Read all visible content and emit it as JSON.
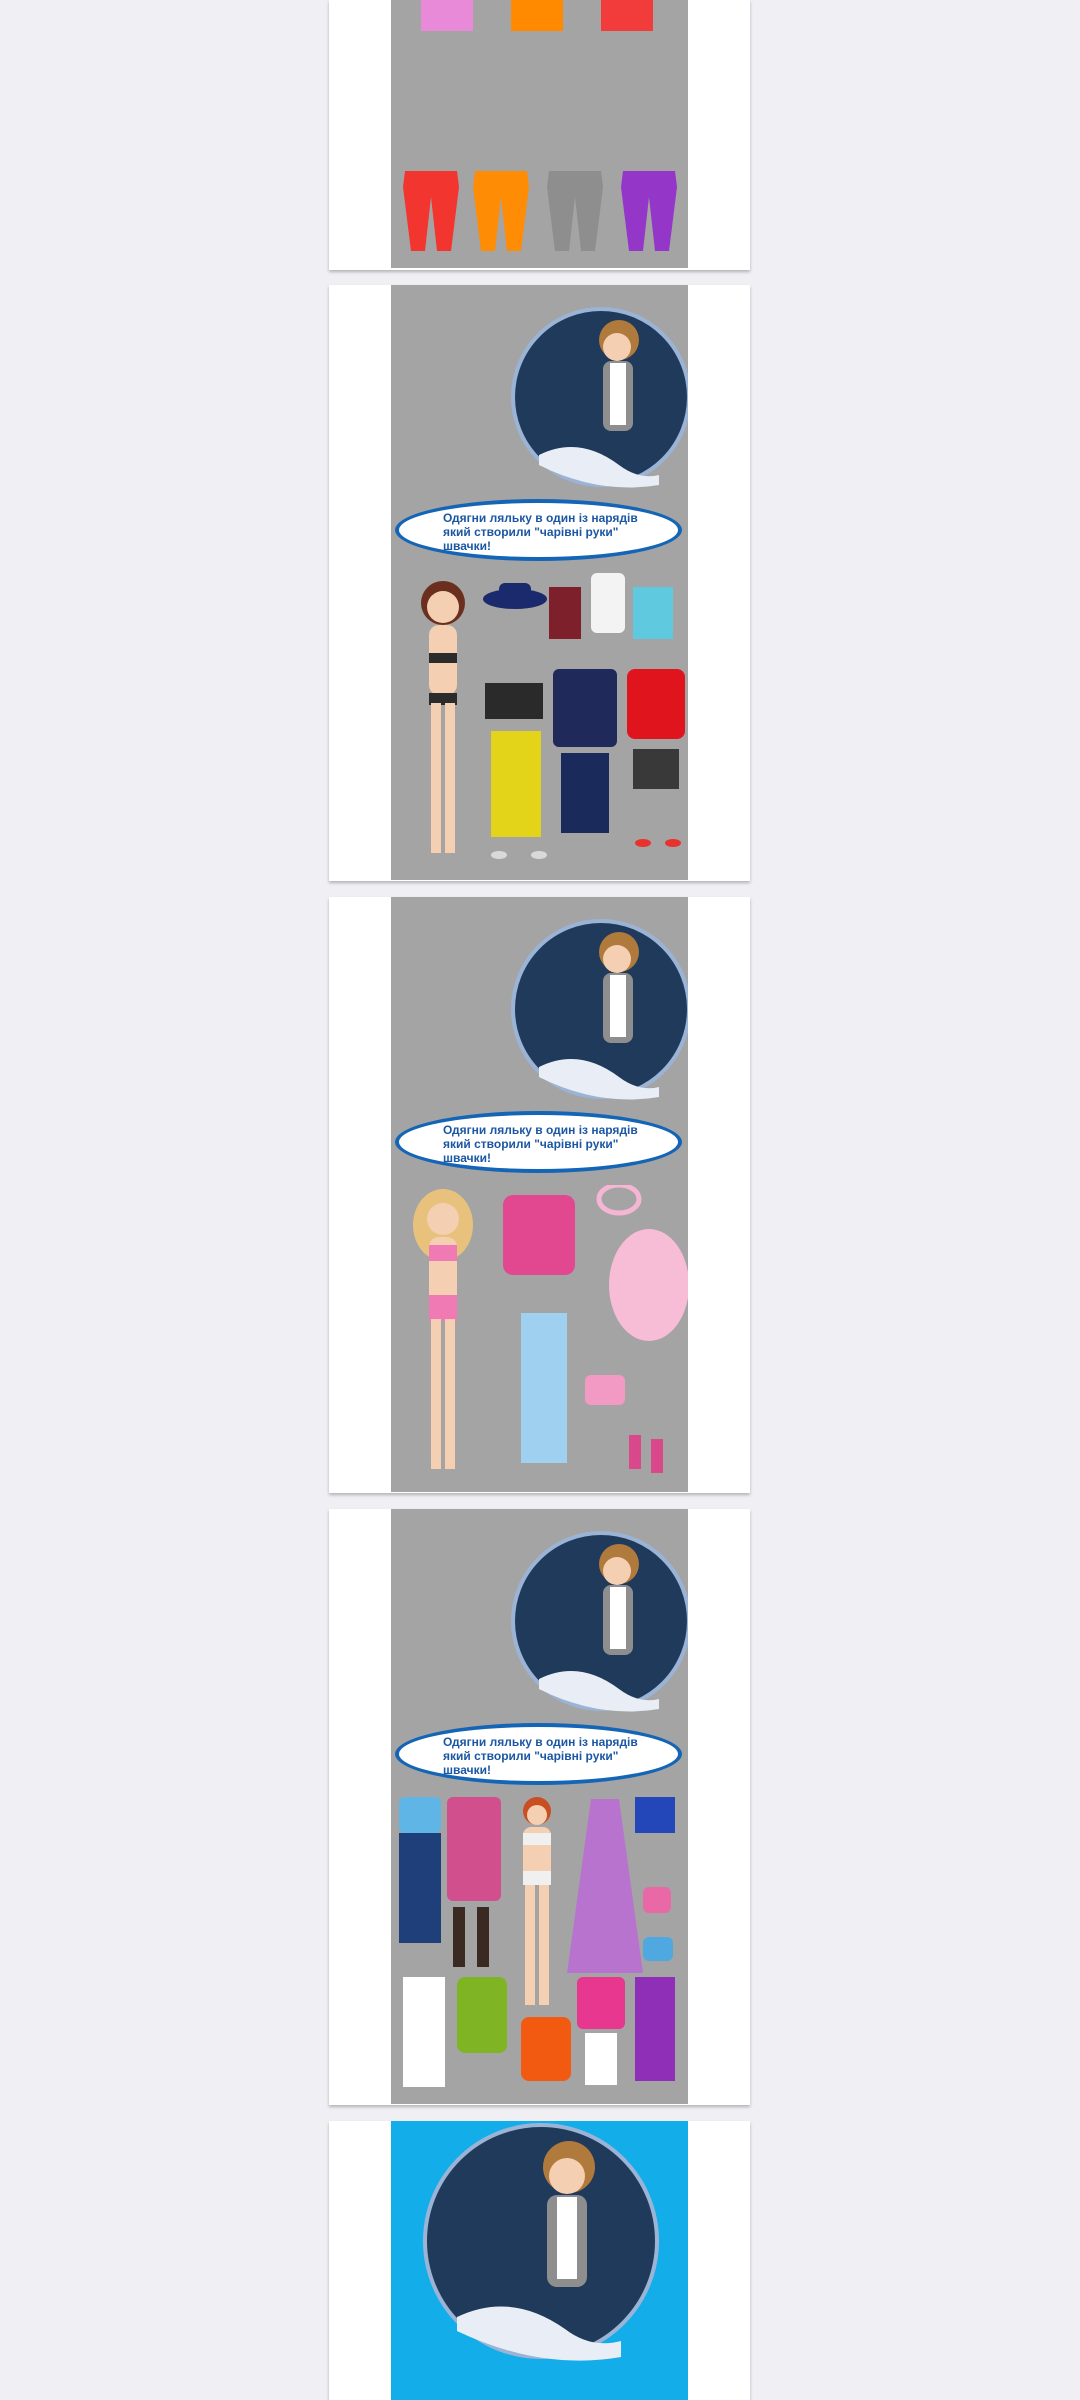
{
  "slides": [
    {
      "id": "colors-and-pants",
      "caption": ""
    },
    {
      "id": "outfit-1",
      "caption": "Одягни ляльку в один із нарядів який створили \"чарівні руки\" швачки!"
    },
    {
      "id": "outfit-2",
      "caption": "Одягни ляльку в один із нарядів який створили \"чарівні руки\" швачки!"
    },
    {
      "id": "outfit-3",
      "caption": "Одягни ляльку в один із нарядів який створили \"чарівні руки\" швачки!"
    },
    {
      "id": "title-blue",
      "caption": ""
    }
  ],
  "colors": {
    "background": "#efeff4",
    "slide_gray": "#a4a4a4",
    "slide_blue": "#13aeea",
    "bubble_border": "#1565b7",
    "bubble_text": "#1b57a3",
    "swatch_pink": "#e98ad8",
    "swatch_orange": "#ff8a00",
    "swatch_red": "#f23c3c"
  },
  "icons": [
    "teacher-illustration",
    "doll-figure",
    "pants-icon",
    "hat-icon",
    "dress-icon",
    "shoe-icon",
    "bag-icon"
  ]
}
